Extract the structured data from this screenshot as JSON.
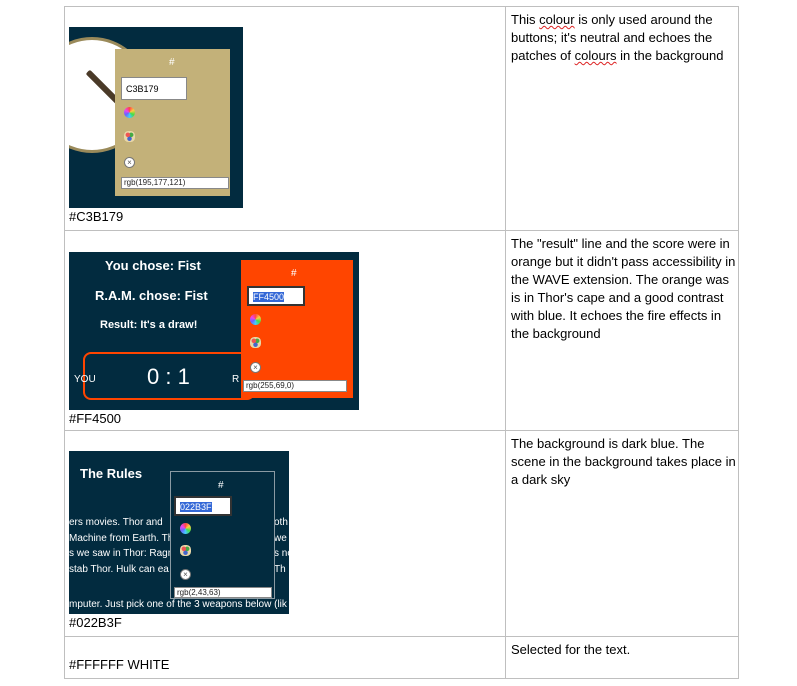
{
  "rows": [
    {
      "hex_label": "#C3B179",
      "description_parts": [
        "This ",
        "colour",
        " is only used around the buttons; it's neutral and echoes the patches of ",
        "colours",
        " in the background"
      ],
      "picker": {
        "hash": "#",
        "input": "C3B179",
        "rgb": "rgb(195,177,121)",
        "bg": "#c3b179"
      }
    },
    {
      "hex_label": "#FF4500",
      "description": "The \"result\" line and the score were in orange but it didn't pass accessibility in the WAVE extension. The orange was is in Thor's cape and a good contrast with blue. It echoes the fire effects in the background",
      "game": {
        "you_chose": "You chose: Fist",
        "ram_chose": "R.A.M. chose: Fist",
        "result": "Result: It's a draw!",
        "you": "YOU",
        "score": "0 : 1",
        "r": "R"
      },
      "picker": {
        "hash": "#",
        "input": "FF4500",
        "rgb": "rgb(255,69,0)",
        "bg": "#ff4500"
      }
    },
    {
      "hex_label": "#022B3F",
      "description": "The background is dark blue. The scene in the background takes place in a dark sky",
      "rules": {
        "title": "The Rules",
        "lines": [
          "ers movies. Thor and",
          "Machine from Earth. Th",
          "s we saw in Thor: Ragn",
          "stab Thor. Hulk can ea",
          "mputer. Just pick one of the 3 weapons below (lik"
        ],
        "right_frags": [
          "oth",
          "we",
          "s no",
          "Th"
        ]
      },
      "picker": {
        "hash": "#",
        "input": "022B3F",
        "rgb": "rgb(2,43,63)",
        "bg": "#022b3f"
      }
    },
    {
      "hex_label": "#FFFFFF WHITE",
      "description": "Selected for the text."
    }
  ],
  "icons": [
    "color-wheel-icon",
    "palette-icon",
    "clear-icon"
  ]
}
